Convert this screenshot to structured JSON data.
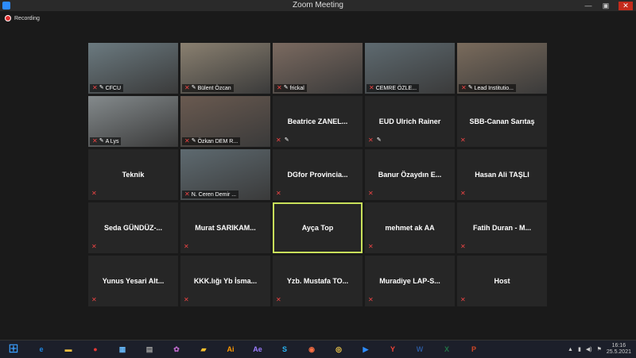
{
  "window": {
    "title": "Zoom Meeting"
  },
  "recording": {
    "label": "Recording"
  },
  "participants": [
    {
      "name": "CFCU",
      "mode": "video",
      "muted": true,
      "pinned": true
    },
    {
      "name": "Bülent Özcan",
      "mode": "video",
      "muted": true,
      "pinned": true
    },
    {
      "name": "frickal",
      "mode": "video",
      "muted": true,
      "pinned": true
    },
    {
      "name": "CEMRE ÖZLE...",
      "mode": "video",
      "muted": true,
      "pinned": false
    },
    {
      "name": "Lead Institutio...",
      "mode": "video",
      "muted": true,
      "pinned": true
    },
    {
      "name": "A Lys",
      "mode": "video",
      "muted": true,
      "pinned": true
    },
    {
      "name": "Özkan DEM R...",
      "mode": "video",
      "muted": true,
      "pinned": true
    },
    {
      "name": "Beatrice ZANEL...",
      "mode": "name",
      "muted": true,
      "pinned": true
    },
    {
      "name": "EUD Ulrich Rainer",
      "mode": "name",
      "muted": true,
      "pinned": true
    },
    {
      "name": "SBB-Canan Sarıtaş",
      "mode": "name",
      "muted": true,
      "pinned": false
    },
    {
      "name": "Teknik",
      "mode": "name",
      "muted": true,
      "pinned": false
    },
    {
      "name": "N. Ceren Demir ...",
      "mode": "video",
      "muted": true,
      "pinned": false
    },
    {
      "name": "DGfor Provincia...",
      "mode": "name",
      "muted": true,
      "pinned": false
    },
    {
      "name": "Banur Özaydın E...",
      "mode": "name",
      "muted": true,
      "pinned": false
    },
    {
      "name": "Hasan Ali TAŞLI",
      "mode": "name",
      "muted": true,
      "pinned": false
    },
    {
      "name": "Seda GÜNDÜZ-...",
      "mode": "name",
      "muted": true,
      "pinned": false
    },
    {
      "name": "Murat SARIKAM...",
      "mode": "name",
      "muted": true,
      "pinned": false
    },
    {
      "name": "Ayça Top",
      "mode": "name",
      "muted": false,
      "pinned": false,
      "active": true
    },
    {
      "name": "mehmet ak AA",
      "mode": "name",
      "muted": true,
      "pinned": false
    },
    {
      "name": "Fatih Duran - M...",
      "mode": "name",
      "muted": true,
      "pinned": false
    },
    {
      "name": "Yunus Yesari Alt...",
      "mode": "name",
      "muted": true,
      "pinned": false
    },
    {
      "name": "KKK.lığı Yb İsma...",
      "mode": "name",
      "muted": true,
      "pinned": false
    },
    {
      "name": "Yzb. Mustafa TO...",
      "mode": "name",
      "muted": true,
      "pinned": false
    },
    {
      "name": "Muradiye LAP-S...",
      "mode": "name",
      "muted": true,
      "pinned": false
    },
    {
      "name": "Host",
      "mode": "name",
      "muted": true,
      "pinned": false
    }
  ],
  "taskbar": {
    "apps": [
      {
        "icon": "ie-icon",
        "glyph": "e",
        "color": "#1e88e5"
      },
      {
        "icon": "folder-icon",
        "glyph": "▬",
        "color": "#f0c040"
      },
      {
        "icon": "chrome-icon",
        "glyph": "●",
        "color": "#e53935"
      },
      {
        "icon": "network-icon",
        "glyph": "▦",
        "color": "#64b5f6"
      },
      {
        "icon": "calculator-icon",
        "glyph": "▤",
        "color": "#9e9e9e"
      },
      {
        "icon": "paint-icon",
        "glyph": "✿",
        "color": "#ba68c8"
      },
      {
        "icon": "folder-2-icon",
        "glyph": "▰",
        "color": "#fbc02d"
      },
      {
        "icon": "illustrator-icon",
        "glyph": "Ai",
        "color": "#ff9800"
      },
      {
        "icon": "after-effects-icon",
        "glyph": "Ae",
        "color": "#9c7cff"
      },
      {
        "icon": "skype-icon",
        "glyph": "S",
        "color": "#29b6f6"
      },
      {
        "icon": "browser-icon",
        "glyph": "◉",
        "color": "#ff7043"
      },
      {
        "icon": "media-icon",
        "glyph": "◎",
        "color": "#ffd54f"
      },
      {
        "icon": "zoom-icon",
        "glyph": "▶",
        "color": "#2d8cff"
      },
      {
        "icon": "yandex-icon",
        "glyph": "Y",
        "color": "#f44336"
      },
      {
        "icon": "word-icon",
        "glyph": "W",
        "color": "#2b579a"
      },
      {
        "icon": "excel-icon",
        "glyph": "X",
        "color": "#217346"
      },
      {
        "icon": "powerpoint-icon",
        "glyph": "P",
        "color": "#d24726"
      }
    ],
    "time": "16:16",
    "date": "25.5.2021"
  }
}
